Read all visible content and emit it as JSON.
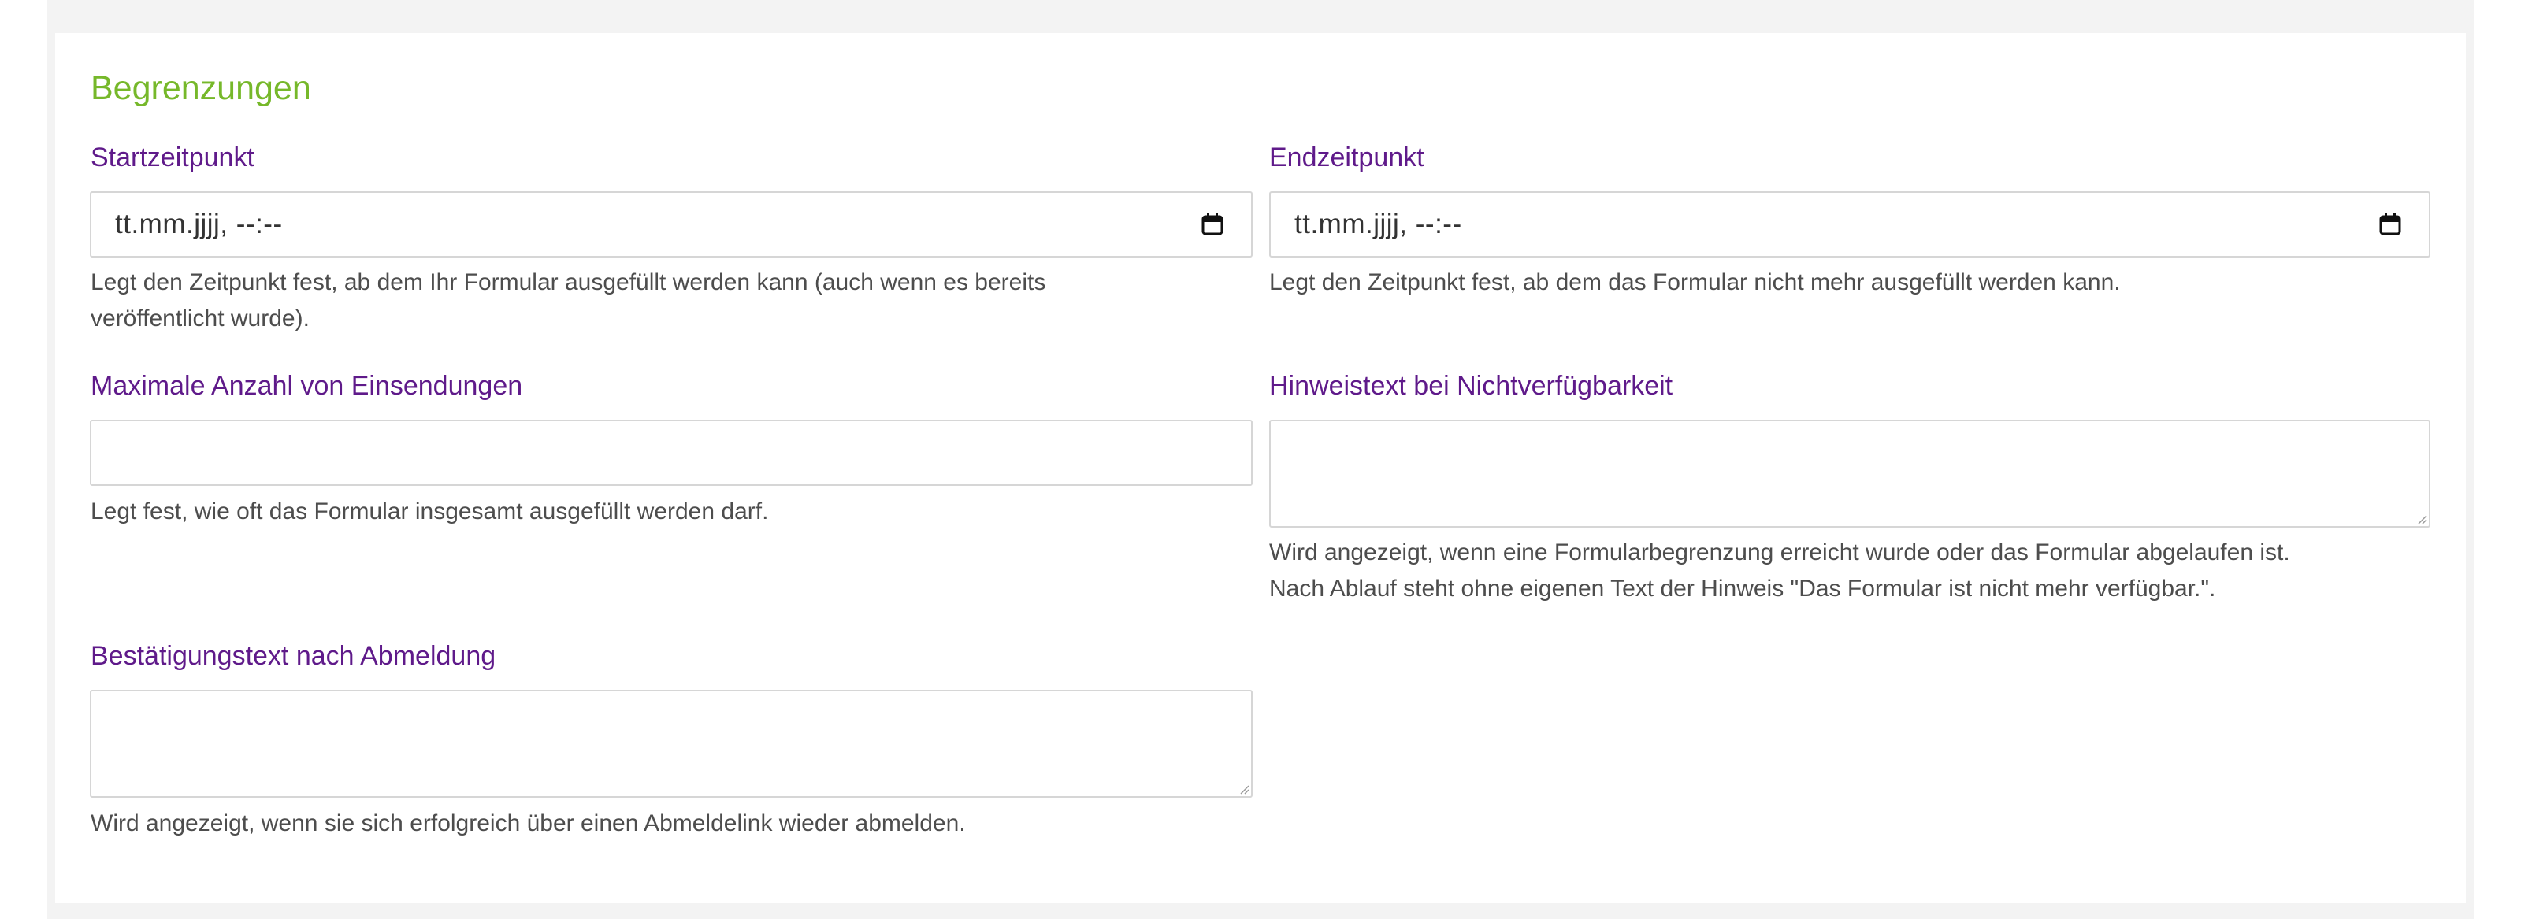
{
  "section": {
    "title": "Begrenzungen"
  },
  "fields": {
    "start": {
      "label": "Startzeitpunkt",
      "placeholder": "tt.mm.jjjj, --:--",
      "help_line1": "Legt den Zeitpunkt fest, ab dem Ihr Formular ausgefüllt werden kann (auch wenn es bereits",
      "help_line2": "veröffentlicht wurde)."
    },
    "end": {
      "label": "Endzeitpunkt",
      "placeholder": "tt.mm.jjjj, --:--",
      "help_line1": "Legt den Zeitpunkt fest, ab dem das Formular nicht mehr ausgefüllt werden kann."
    },
    "max_submissions": {
      "label": "Maximale Anzahl von Einsendungen",
      "value": "",
      "help_line1": "Legt fest, wie oft das Formular insgesamt ausgefüllt werden darf."
    },
    "unavailable_notice": {
      "label": "Hinweistext bei Nichtverfügbarkeit",
      "value": "",
      "help_line1": "Wird angezeigt, wenn eine Formularbegrenzung erreicht wurde oder das Formular abgelaufen ist.",
      "help_line2": "Nach Ablauf steht ohne eigenen Text der Hinweis \"Das Formular ist nicht mehr verfügbar.\"."
    },
    "unsubscribe_confirmation": {
      "label": "Bestätigungstext nach Abmeldung",
      "value": "",
      "help_line1": "Wird angezeigt, wenn sie sich erfolgreich über einen Abmeldelink wieder abmelden."
    }
  },
  "icons": {
    "calendar": "calendar-icon",
    "resize": "resize-grip-icon"
  },
  "colors": {
    "section_title": "#76b82a",
    "field_label": "#5f1a8a",
    "help_text": "#4d4d4d",
    "input_border": "#d6d6d6",
    "page_background": "#f3f3f3"
  }
}
